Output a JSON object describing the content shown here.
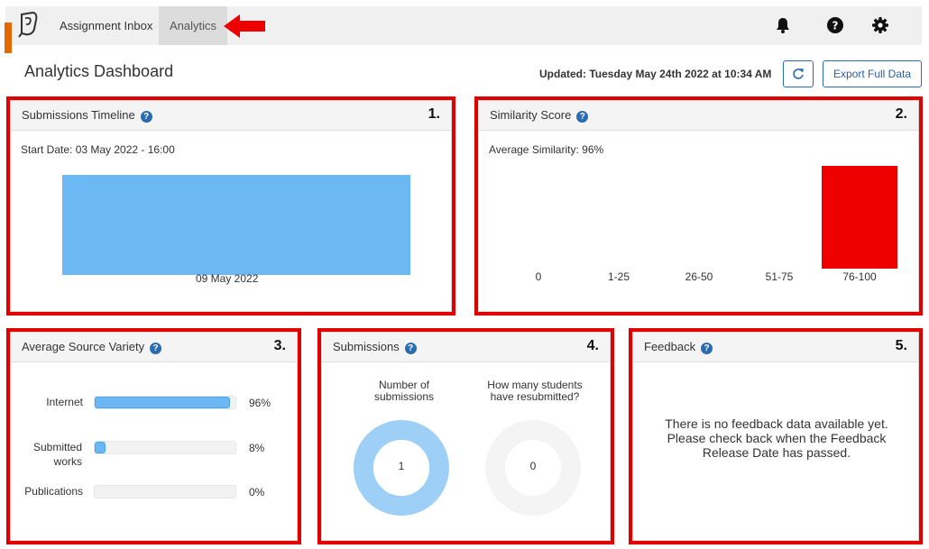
{
  "nav": {
    "inbox_label": "Assignment Inbox",
    "analytics_label": "Analytics"
  },
  "icons": {
    "logo": "feedback-studio-logo-icon",
    "arrow": "red-arrow-icon",
    "bell": "bell-icon",
    "help": "question-circle-icon",
    "settings": "gear-icon",
    "refresh": "refresh-icon"
  },
  "header": {
    "title": "Analytics Dashboard",
    "updated": "Updated: Tuesday May 24th 2022 at 10:34 AM",
    "export_label": "Export Full Data"
  },
  "colors": {
    "highlight_red": "#e00000",
    "accent_blue": "#2b6cb0",
    "bar_blue": "#6cb8f5",
    "bar_red": "#ee0000",
    "orange": "#e46a00"
  },
  "panels": {
    "timeline": {
      "title": "Submissions Timeline",
      "number": "1.",
      "start_date": "Start Date: 03 May 2022 - 16:00",
      "bar_label": "09 May 2022"
    },
    "similarity": {
      "title": "Similarity Score",
      "number": "2.",
      "average": "Average Similarity: 96%"
    },
    "source_variety": {
      "title": "Average Source Variety",
      "number": "3.",
      "rows": [
        {
          "label": "Internet",
          "percent_label": "96%",
          "value": 96
        },
        {
          "label": "Submitted works",
          "percent_label": "8%",
          "value": 8
        },
        {
          "label": "Publications",
          "percent_label": "0%",
          "value": 0
        }
      ]
    },
    "submissions": {
      "title": "Submissions",
      "number": "4.",
      "num_label": "Number of submissions",
      "num_value": "1",
      "resub_label": "How many students have resubmitted?",
      "resub_value": "0"
    },
    "feedback": {
      "title": "Feedback",
      "number": "5.",
      "message": "There is no feedback data available yet. Please check back when the Feedback Release Date has passed."
    }
  },
  "chart_data": [
    {
      "type": "bar",
      "categories": [
        "09 May 2022"
      ],
      "values": [
        1
      ]
    },
    {
      "type": "bar",
      "categories": [
        "0",
        "1-25",
        "26-50",
        "51-75",
        "76-100"
      ],
      "values": [
        0,
        0,
        0,
        0,
        1
      ],
      "ylim": [
        0,
        1
      ]
    }
  ]
}
